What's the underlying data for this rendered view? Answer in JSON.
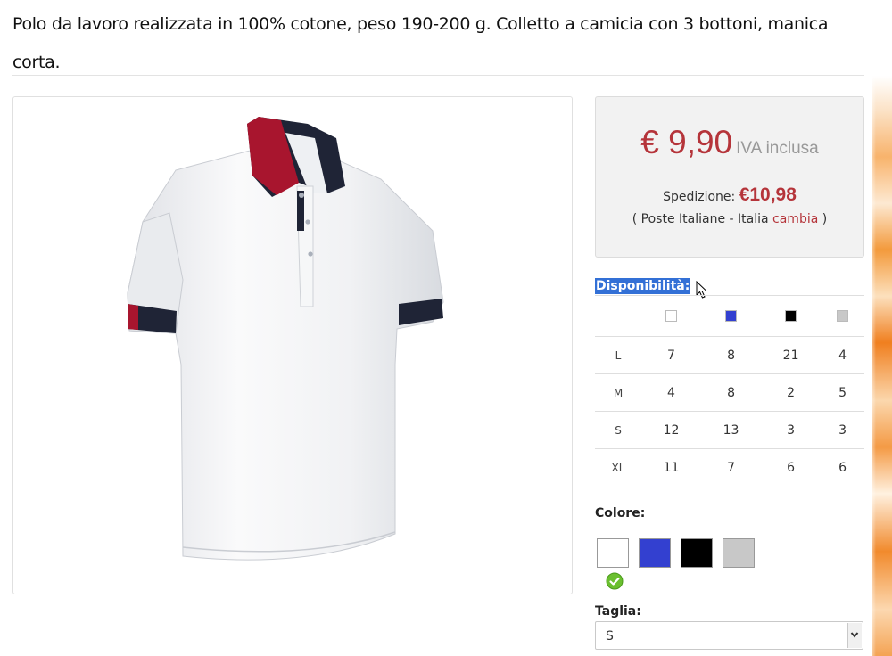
{
  "product": {
    "description": "Polo da lavoro realizzata in 100% cotone, peso 190-200 g. Colletto a camicia con 3 bottoni, manica corta."
  },
  "price": {
    "amount": "€ 9,90",
    "tax_note": "IVA inclusa",
    "shipping_label": "Spedizione:",
    "shipping_amount": "€10,98",
    "carrier_prefix": "( Poste Italiane - Italia",
    "change_link": "cambia",
    "carrier_suffix": ")"
  },
  "availability": {
    "label": "Disponibilità:",
    "colors": [
      "#ffffff",
      "#3340d0",
      "#000000",
      "#c8c8c8"
    ],
    "rows": [
      {
        "size": "L",
        "values": [
          "7",
          "8",
          "21",
          "4"
        ]
      },
      {
        "size": "M",
        "values": [
          "4",
          "8",
          "2",
          "5"
        ]
      },
      {
        "size": "S",
        "values": [
          "12",
          "13",
          "3",
          "3"
        ]
      },
      {
        "size": "XL",
        "values": [
          "11",
          "7",
          "6",
          "6"
        ]
      }
    ]
  },
  "color_picker": {
    "label": "Colore:",
    "options": [
      "#ffffff",
      "#3340d0",
      "#000000",
      "#c8c8c8"
    ],
    "selected_index": 0,
    "selected_icon": "check-circle-icon"
  },
  "size_picker": {
    "label": "Taglia:",
    "selected": "S"
  },
  "colors": {
    "accent": "#b5343a",
    "selection": "#3370d6"
  }
}
